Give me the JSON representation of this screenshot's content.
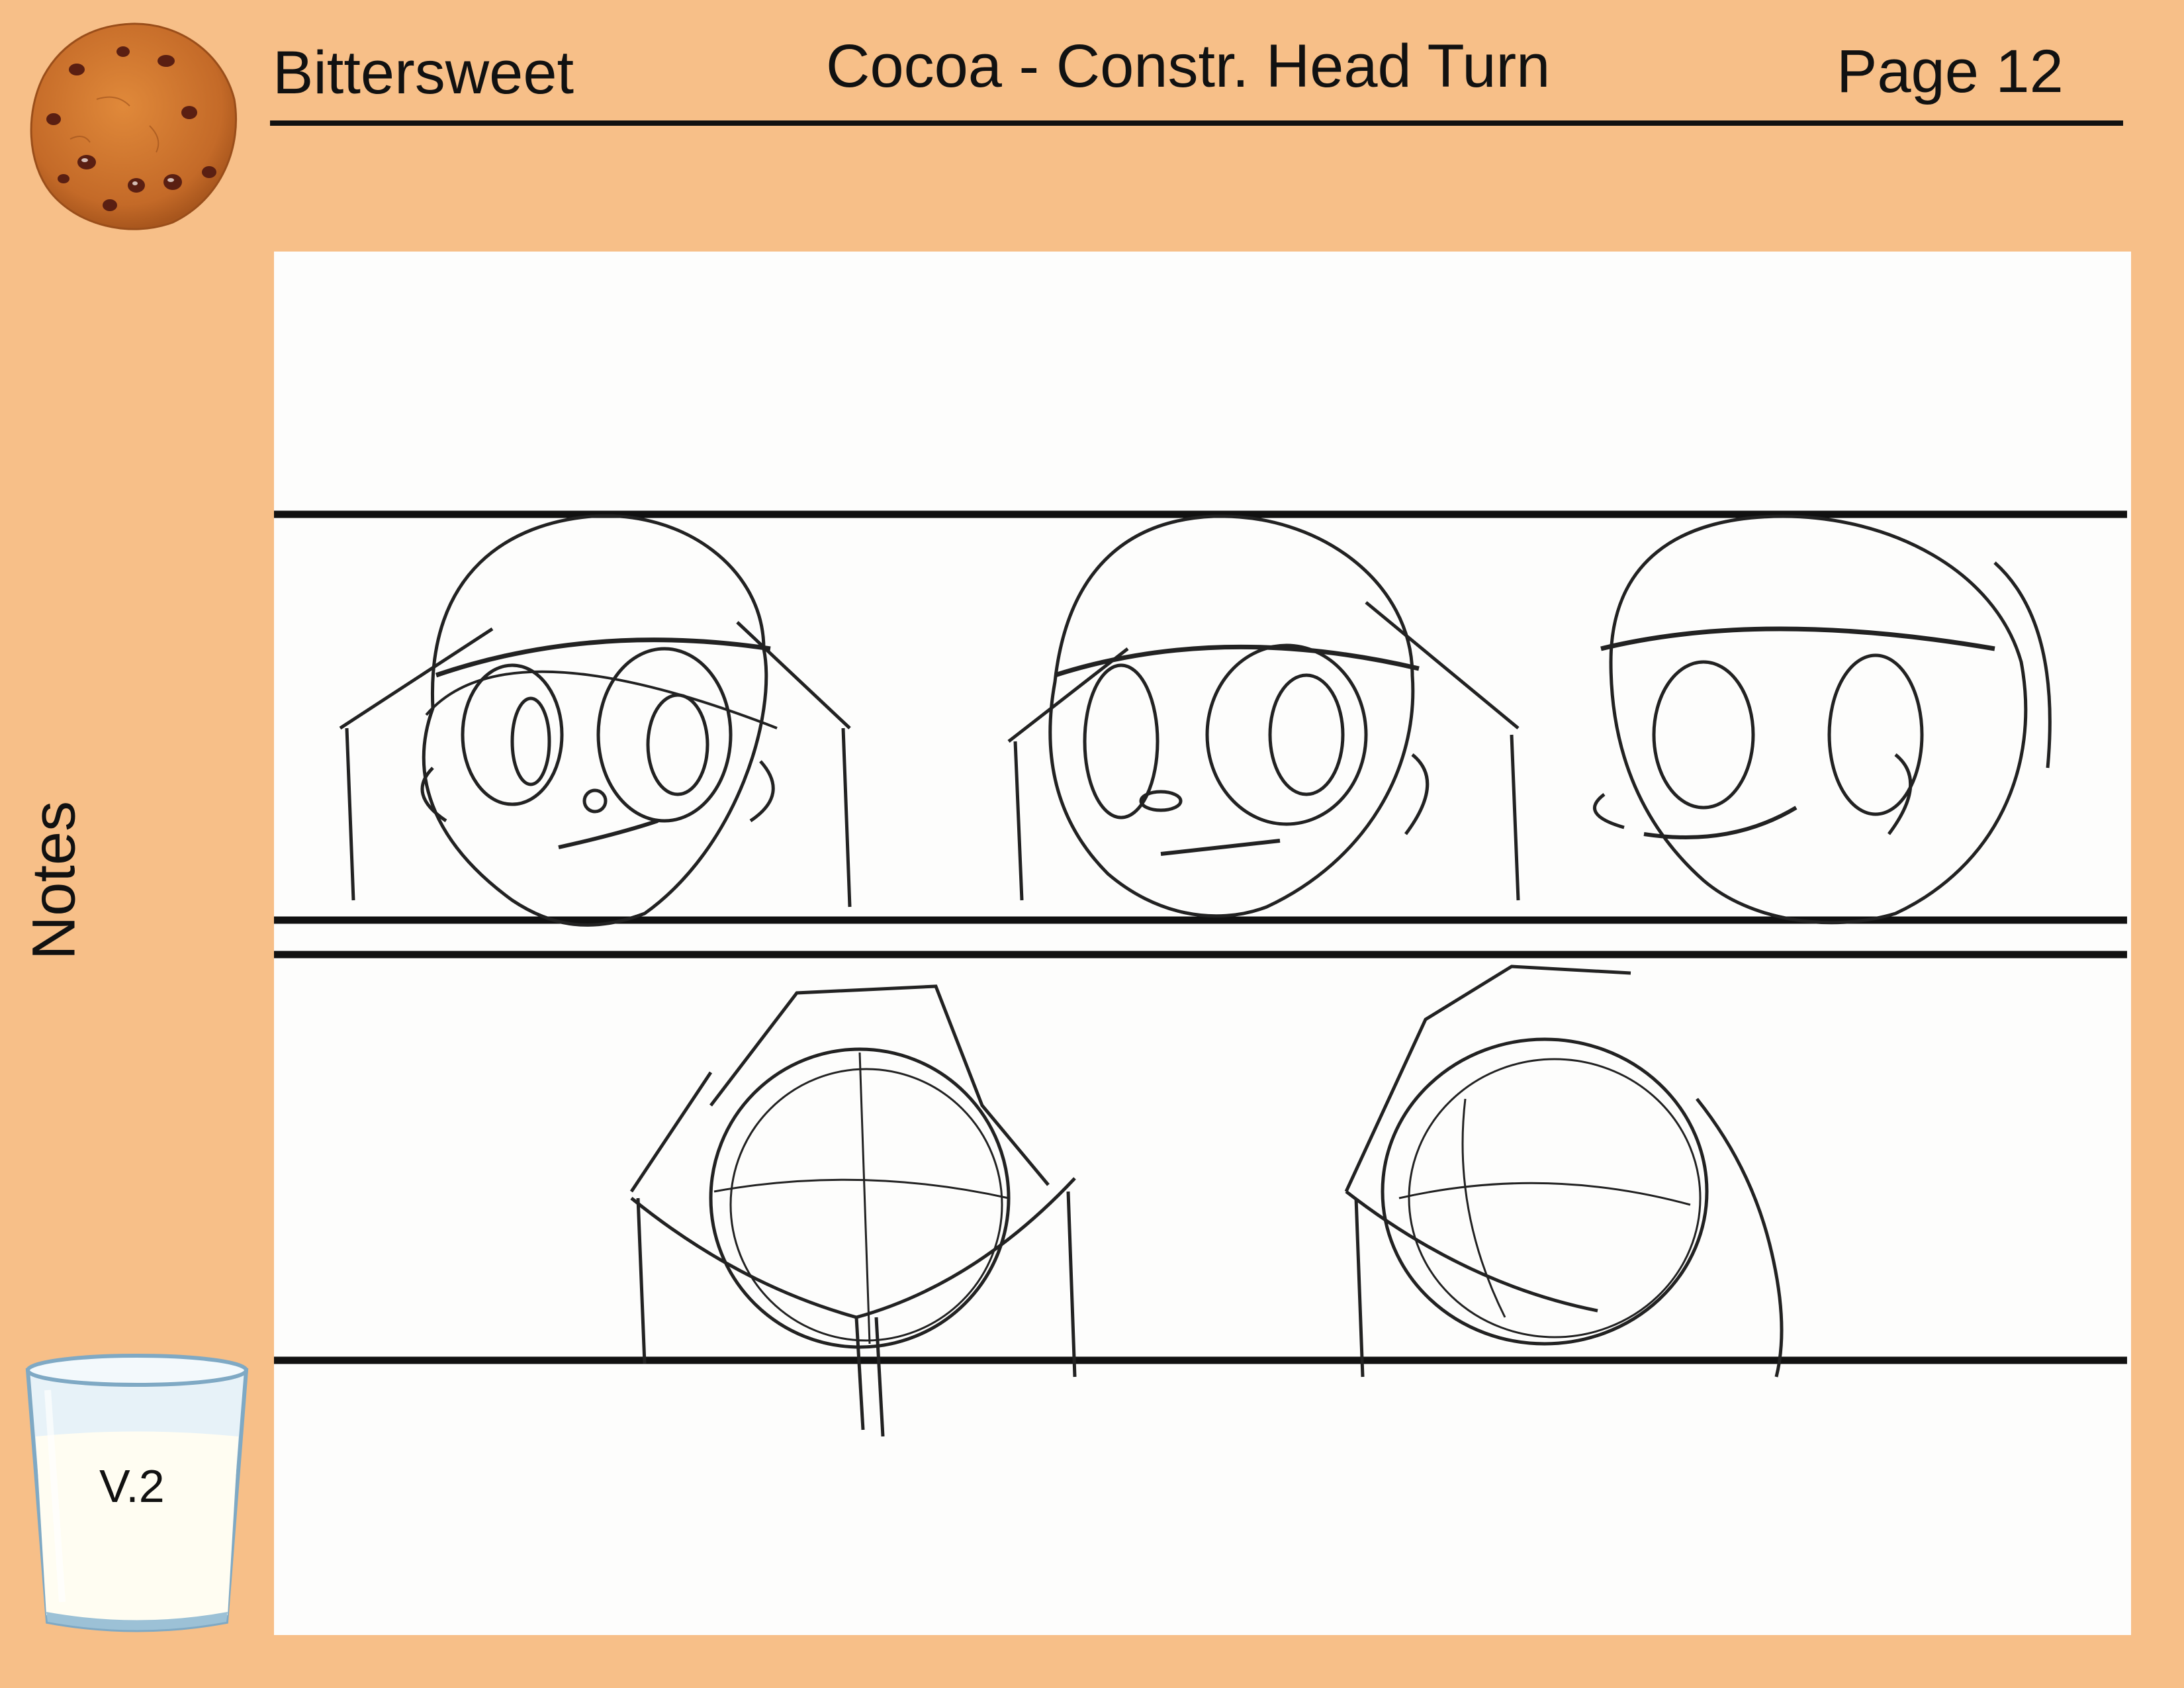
{
  "header": {
    "project_title": "Bittersweet",
    "sheet_title": "Cocoa - Constr. Head Turn",
    "page_label": "Page 12"
  },
  "sidebar": {
    "notes_label": "Notes",
    "version_label": "V.2"
  },
  "icons": {
    "logo": "chocolate-chip-cookie-icon",
    "version_badge": "milk-glass-icon"
  },
  "colors": {
    "page_background": "#F7BF88",
    "panel_background": "#FDFDFC",
    "ink": "#111111",
    "cookie": "#C8702E",
    "milk_glass_rim": "#7FA9C4"
  }
}
